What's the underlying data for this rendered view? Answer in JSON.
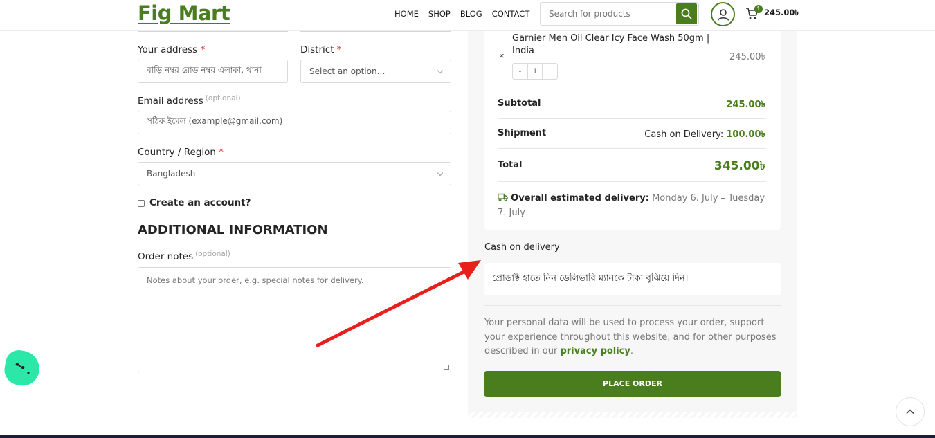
{
  "header": {
    "logo": "Fig Mart",
    "nav": [
      "HOME",
      "SHOP",
      "BLOG",
      "CONTACT"
    ],
    "search_placeholder": "Search for products",
    "cart_count": "1",
    "cart_total": "245.00৳"
  },
  "form": {
    "address_label": "Your address",
    "address_required": "*",
    "address_placeholder": "বাড়ি নম্বর রোড নম্বর এলাকা, থানা",
    "district_label": "District",
    "district_required": "*",
    "district_placeholder": "Select an option…",
    "email_label": "Email address",
    "email_optional": "(optional)",
    "email_placeholder": "সঠিক ইমেল (example@gmail.com)",
    "country_label": "Country / Region",
    "country_required": "*",
    "country_value": "Bangladesh",
    "create_account": "Create an account?",
    "additional_title": "ADDITIONAL INFORMATION",
    "notes_label": "Order notes",
    "notes_optional": "(optional)",
    "notes_placeholder": "Notes about your order, e.g. special notes for delivery."
  },
  "order": {
    "product_name": "Garnier Men Oil Clear Icy Face Wash 50gm | India",
    "remove_icon": "×",
    "product_price": "245.00৳",
    "qty_minus": "-",
    "qty_value": "1",
    "qty_plus": "+",
    "subtotal_label": "Subtotal",
    "subtotal_value": "245.00৳",
    "shipment_label": "Shipment",
    "shipment_method": "Cash on Delivery:",
    "shipment_value": "100.00৳",
    "total_label": "Total",
    "total_value": "345.00৳",
    "delivery_label": "Overall estimated delivery:",
    "delivery_value": "Monday 6. July – Tuesday 7. July"
  },
  "payment": {
    "method_title": "Cash on delivery",
    "method_desc": "প্রোডাক্ট হাতে নিন ডেলিভারি ম্যানকে টাকা বুঝিয়ে দিন।"
  },
  "privacy": {
    "text": "Your personal data will be used to process your order, support your experience throughout this website, and for other purposes described in our",
    "link": "privacy policy",
    "end": "."
  },
  "place_order_label": "PLACE ORDER",
  "colors": {
    "brand_green": "#4a7d1e",
    "required_red": "#e01e1e",
    "annotation_arrow": "#e8201c",
    "chat_bubble": "#2ce8a8"
  }
}
